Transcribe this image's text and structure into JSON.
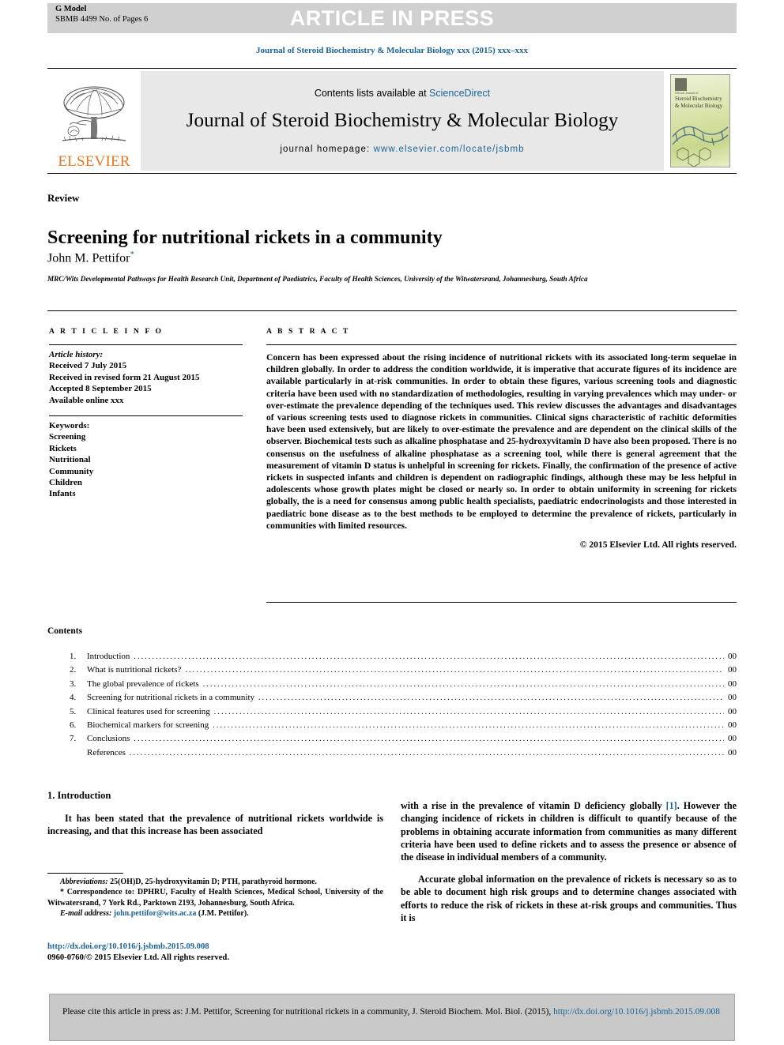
{
  "banner": {
    "g_model": "G Model",
    "doc_id": "SBMB 4499 No. of Pages 6",
    "article_in_press": "ARTICLE IN PRESS"
  },
  "running_head": "Journal of Steroid Biochemistry & Molecular Biology xxx (2015) xxx–xxx",
  "masthead": {
    "contents_prefix": "Contents lists available at ",
    "sciencedirect": "ScienceDirect",
    "journal_title": "Journal of Steroid Biochemistry & Molecular Biology",
    "homepage_prefix": "journal homepage: ",
    "homepage_url": "www.elsevier.com/locate/jsbmb",
    "publisher": "ELSEVIER",
    "cover_title": "Steroid Biochemistry & Molecular Biology",
    "cover_kicker": "Official Journal of"
  },
  "article": {
    "section_type": "Review",
    "title": "Screening for nutritional rickets in a community",
    "author": "John M. Pettifor",
    "author_mark": "*",
    "affiliation": "MRC/Wits Developmental Pathways for Health Research Unit, Department of Paediatrics, Faculty of Health Sciences, University of the Witwatersrand, Johannesburg, South Africa"
  },
  "article_info": {
    "heading": "A R T I C L E   I N F O",
    "history_label": "Article history:",
    "history": [
      "Received 7 July 2015",
      "Received in revised form 21 August 2015",
      "Accepted 8 September 2015",
      "Available online xxx"
    ],
    "keywords_label": "Keywords:",
    "keywords": [
      "Screening",
      "Rickets",
      "Nutritional",
      "Community",
      "Children",
      "Infants"
    ]
  },
  "abstract": {
    "heading": "A B S T R A C T",
    "text": "Concern has been expressed about the rising incidence of nutritional rickets with its associated long-term sequelae in children globally. In order to address the condition worldwide, it is imperative that accurate figures of its incidence are available particularly in at-risk communities. In order to obtain these figures, various screening tools and diagnostic criteria have been used with no standardization of methodologies, resulting in varying prevalences which may under- or over-estimate the prevalence depending of the techniques used. This review discusses the advantages and disadvantages of various screening tests used to diagnose rickets in communities. Clinical signs characteristic of rachitic deformities have been used extensively, but are likely to over-estimate the prevalence and are dependent on the clinical skills of the observer. Biochemical tests such as alkaline phosphatase and 25-hydroxyvitamin D have also been proposed. There is no consensus on the usefulness of alkaline phosphatase as a screening tool, while there is general agreement that the measurement of vitamin D status is unhelpful in screening for rickets. Finally, the confirmation of the presence of active rickets in suspected infants and children is dependent on radiographic findings, although these may be less helpful in adolescents whose growth plates might be closed or nearly so. In order to obtain uniformity in screening for rickets globally, the is a need for consensus among public health specialists, paediatric endocrinologists and those interested in paediatric bone disease as to the best methods to be employed to determine the prevalence of rickets, particularly in communities with limited resources.",
    "copyright": "© 2015 Elsevier Ltd. All rights reserved."
  },
  "contents": {
    "heading": "Contents",
    "items": [
      {
        "num": "1.",
        "label": "Introduction",
        "page": "00"
      },
      {
        "num": "2.",
        "label": "What is nutritional rickets?",
        "page": "00"
      },
      {
        "num": "3.",
        "label": "The global prevalence of rickets",
        "page": "00"
      },
      {
        "num": "4.",
        "label": "Screening for nutritional rickets in a community",
        "page": "00"
      },
      {
        "num": "5.",
        "label": "Clinical features used for screening",
        "page": "00"
      },
      {
        "num": "6.",
        "label": "Biochemical markers for screening",
        "page": "00"
      },
      {
        "num": "7.",
        "label": "Conclusions",
        "page": "00"
      },
      {
        "num": "",
        "label": "References",
        "page": "00"
      }
    ]
  },
  "body": {
    "section_heading": "1. Introduction",
    "left_para_1": "It has been stated that the prevalence of nutritional rickets worldwide is increasing, and that this increase has been associated",
    "right_para_1_a": "with a rise in the prevalence of vitamin D deficiency globally ",
    "right_para_1_ref": "[1]",
    "right_para_1_b": ". However the changing incidence of rickets in children is difficult to quantify because of the problems in obtaining accurate information from communities as many different criteria have been used to define rickets and to assess the presence or absence of the disease in individual members of a community.",
    "right_para_2": "Accurate global information on the prevalence of rickets is necessary so as to be able to document high risk groups and to determine changes associated with efforts to reduce the risk of rickets in these at-risk groups and communities. Thus it is"
  },
  "footnotes": {
    "abbrev_label": "Abbreviations:",
    "abbrev_text": " 25(OH)D, 25-hydroxyvitamin D; PTH, parathyroid hormone.",
    "corr_mark": "*",
    "corr_text": " Correspondence to: DPHRU, Faculty of Health Sciences, Medical School, University of the Witwatersrand, 7 York Rd., Parktown 2193, Johannesburg, South Africa.",
    "email_label": "E-mail address:",
    "email": "john.pettifor@wits.ac.za",
    "email_suffix": " (J.M. Pettifor).",
    "doi": "http://dx.doi.org/10.1016/j.jsbmb.2015.09.008",
    "issn_copyright": "0960-0760/© 2015 Elsevier Ltd. All rights reserved."
  },
  "citation_box": {
    "text_a": "Please cite this article in press as: J.M. Pettifor, Screening for nutritional rickets in a community, J. Steroid Biochem. Mol. Biol. (2015), ",
    "link": "http://dx.doi.org/10.1016/j.jsbmb.2015.09.008"
  },
  "colors": {
    "link": "#1a6496",
    "elsevier_orange": "#E87722",
    "banner_grey": "#d0d0d0",
    "masthead_grey": "#e8e8e8",
    "cite_grey": "#c9c9c9"
  }
}
